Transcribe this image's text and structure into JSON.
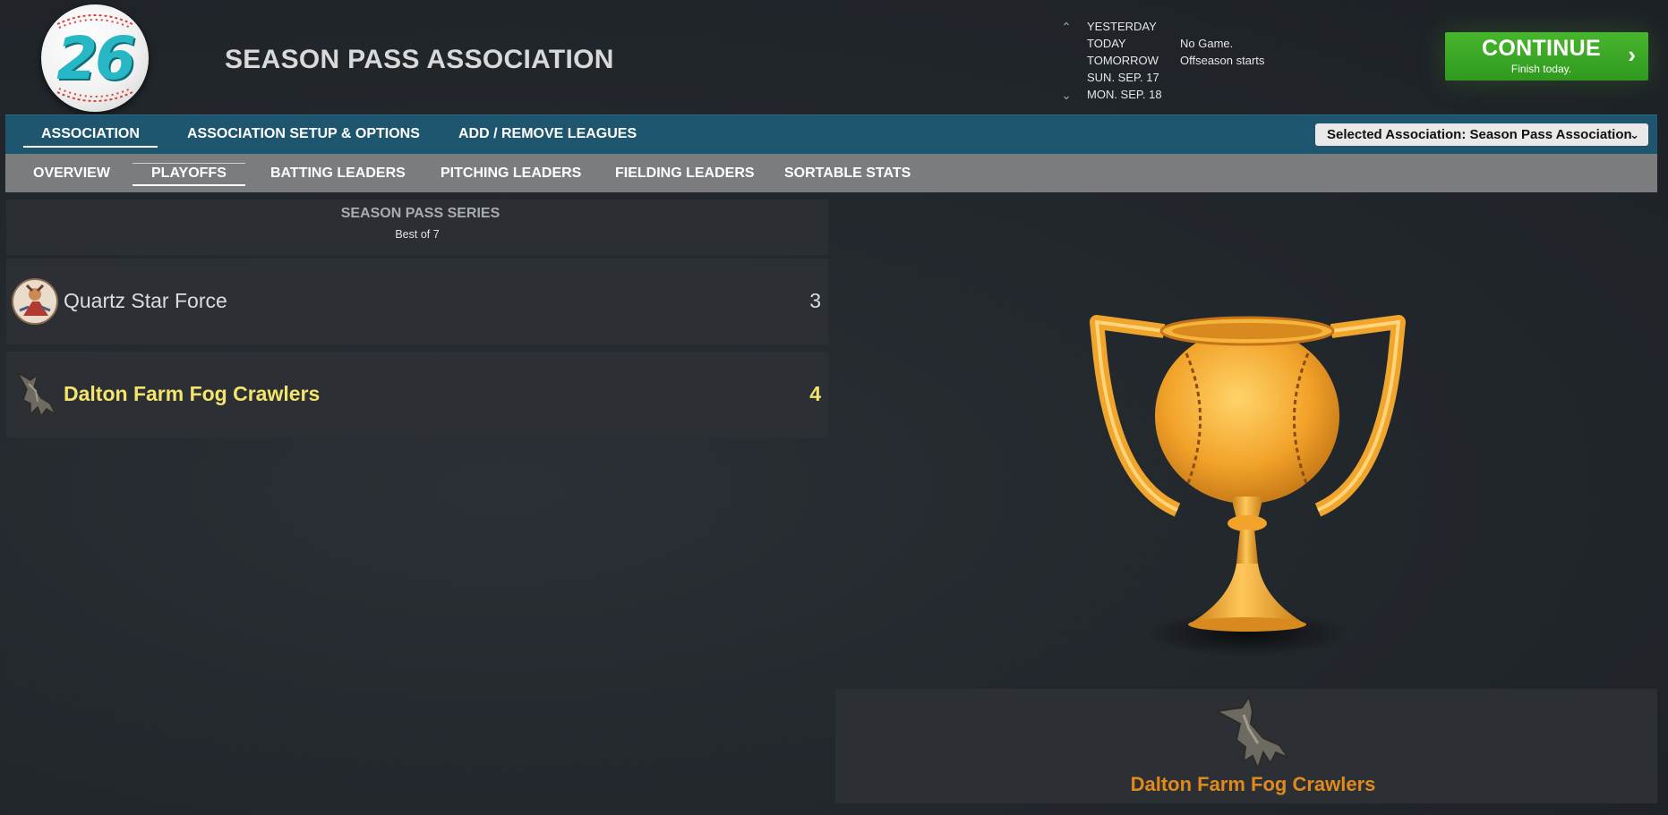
{
  "app": {
    "logo_number": "26",
    "title": "SEASON PASS ASSOCIATION"
  },
  "date_nav": {
    "up_icon": "chevron-up-icon",
    "down_icon": "chevron-down-icon",
    "rows": [
      {
        "day": "YESTERDAY",
        "event": ""
      },
      {
        "day": "TODAY",
        "event": "No Game."
      },
      {
        "day": "TOMORROW",
        "event": "Offseason starts"
      },
      {
        "day": "SUN. SEP. 17",
        "event": ""
      },
      {
        "day": "MON. SEP. 18",
        "event": ""
      }
    ]
  },
  "continue_button": {
    "label": "CONTINUE",
    "sublabel": "Finish today.",
    "icon": "chevron-right-icon",
    "color": "#3fa826"
  },
  "main_nav": {
    "tabs": [
      "ASSOCIATION",
      "ASSOCIATION SETUP & OPTIONS",
      "ADD / REMOVE LEAGUES"
    ],
    "active": "ASSOCIATION",
    "association_select": "Selected Association: Season Pass Association"
  },
  "sub_nav": {
    "tabs": [
      "OVERVIEW",
      "PLAYOFFS",
      "BATTING LEADERS",
      "PITCHING LEADERS",
      "FIELDING LEADERS",
      "SORTABLE STATS"
    ],
    "active": "PLAYOFFS"
  },
  "series": {
    "title": "SEASON PASS SERIES",
    "subtitle": "Best of 7",
    "teams": [
      {
        "name": "Quartz Star Force",
        "wins": "3",
        "icon": "quartz-star-force-logo-icon",
        "winner": false
      },
      {
        "name": "Dalton Farm Fog Crawlers",
        "wins": "4",
        "icon": "fog-crawlers-logo-icon",
        "winner": true
      }
    ],
    "winner_color": "#f3e56c"
  },
  "champion": {
    "trophy_icon": "trophy-icon",
    "name": "Dalton Farm Fog Crawlers",
    "icon": "fog-crawlers-logo-icon",
    "color": "#e08a1e"
  }
}
